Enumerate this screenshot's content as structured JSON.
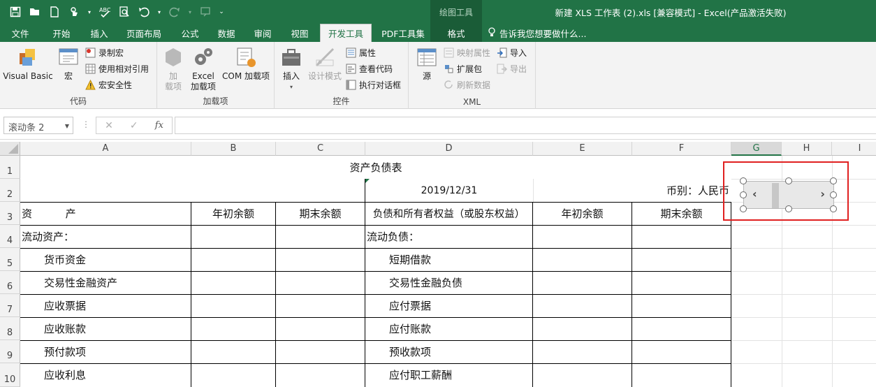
{
  "app": {
    "window_title": "新建 XLS 工作表 (2).xls  [兼容模式] - Excel(产品激活失败)",
    "context_tools": "绘图工具"
  },
  "qat": {
    "icons": [
      "save-icon",
      "open-icon",
      "new-icon",
      "touch-mode-icon",
      "spellcheck-icon",
      "print-preview-icon",
      "undo-icon",
      "redo-icon",
      "customize-icon"
    ]
  },
  "tabs": [
    {
      "label": "文件"
    },
    {
      "label": "开始"
    },
    {
      "label": "插入"
    },
    {
      "label": "页面布局"
    },
    {
      "label": "公式"
    },
    {
      "label": "数据"
    },
    {
      "label": "审阅"
    },
    {
      "label": "视图"
    },
    {
      "label": "开发工具",
      "active": true
    },
    {
      "label": "PDF工具集"
    },
    {
      "label": "格式",
      "context": true
    }
  ],
  "tell_me": "告诉我您想要做什么...",
  "ribbon": {
    "code": {
      "label": "代码",
      "visual_basic": "Visual Basic",
      "macros": "宏",
      "record_macro": "录制宏",
      "relative_ref": "使用相对引用",
      "macro_security": "宏安全性"
    },
    "addins": {
      "label": "加载项",
      "addins_line1": "加",
      "addins_line2": "载项",
      "excel_addins_line1": "Excel",
      "excel_addins_line2": "加载项",
      "com_addins": "COM 加载项"
    },
    "controls": {
      "label": "控件",
      "insert": "插入",
      "design_mode": "设计模式",
      "properties": "属性",
      "view_code": "查看代码",
      "run_dialog": "执行对话框"
    },
    "xml": {
      "label": "XML",
      "source": "源",
      "map_props": "映射属性",
      "expansion_packs": "扩展包",
      "refresh_data": "刷新数据",
      "import": "导入",
      "export": "导出"
    }
  },
  "formula_bar": {
    "name_box": "滚动条 2",
    "cancel": "✕",
    "enter": "✓",
    "fx": "fx",
    "formula": ""
  },
  "columns": [
    "A",
    "B",
    "C",
    "D",
    "E",
    "F",
    "G",
    "H",
    "I"
  ],
  "rows": [
    "1",
    "2",
    "3",
    "4",
    "5",
    "6",
    "7",
    "8",
    "9",
    "10"
  ],
  "cells": {
    "title": "资产负债表",
    "date": "2019/12/31",
    "currency": "币别：人民币",
    "h_assets": "资          产",
    "h_begin1": "年初余额",
    "h_end1": "期末余额",
    "h_liab": "负债和所有者权益（或股东权益）",
    "h_begin2": "年初余额",
    "h_end2": "期末余额",
    "left": [
      "流动资产：",
      "货币资金",
      "交易性金融资产",
      "应收票据",
      "应收账款",
      "预付款项",
      "应收利息"
    ],
    "right": [
      "流动负债：",
      "短期借款",
      "交易性金融负债",
      "应付票据",
      "应付账款",
      "预收款项",
      "应付职工薪酬"
    ]
  },
  "scrollbar_control": {
    "left_arrow": "‹",
    "right_arrow": "›"
  }
}
